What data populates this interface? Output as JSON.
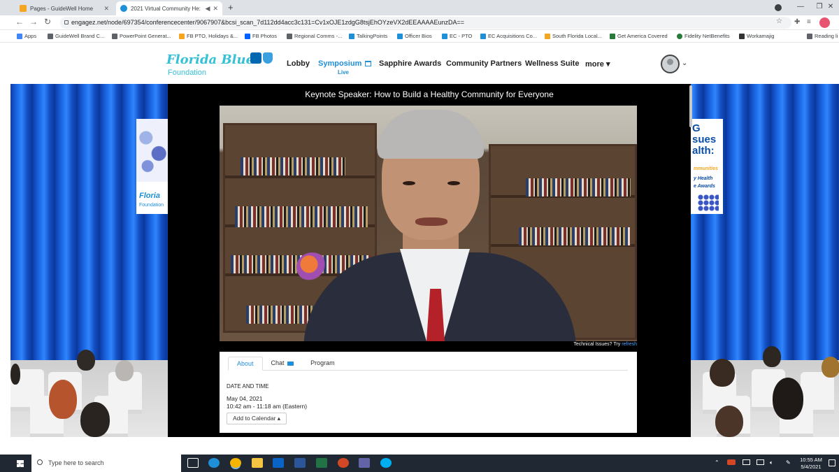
{
  "browser": {
    "tabs": [
      {
        "title": "Pages - GuideWell Home",
        "close": "✕"
      },
      {
        "title": "2021 Virtual Community He:",
        "audio": "◀",
        "close": "✕"
      }
    ],
    "new_tab": "+",
    "window_controls": {
      "minimize": "—",
      "maximize": "❐",
      "close": "✕"
    },
    "url": "engagez.net/node/697354/conferencecenter/9067907&bcsi_scan_7d112dd4acc3c131=Cv1xOJE1zdgG8tsjEhOYzeVX2dEEAAAAEunzDA==",
    "bookmarks": [
      {
        "label": "Apps",
        "color": "#4285f4"
      },
      {
        "label": "GuideWell Brand C...",
        "color": "#5f6368"
      },
      {
        "label": "PowerPoint Generat...",
        "color": "#5f6368"
      },
      {
        "label": "FB PTO, Holidays &...",
        "color": "#f4a620"
      },
      {
        "label": "FB Photos",
        "color": "#0061fe"
      },
      {
        "label": "Regional Comms -...",
        "color": "#5f6368"
      },
      {
        "label": "TalkingPoints",
        "color": "#1f8fd8"
      },
      {
        "label": "Officer Bios",
        "color": "#1f8fd8"
      },
      {
        "label": "EC - PTO",
        "color": "#1f8fd8"
      },
      {
        "label": "EC Acquisitions Co...",
        "color": "#1f8fd8"
      },
      {
        "label": "South Florida Local...",
        "color": "#f4a620"
      },
      {
        "label": "Get America Covered",
        "color": "#2a7a3a"
      },
      {
        "label": "Fidelity NetBenefits",
        "color": "#2a7a3a"
      },
      {
        "label": "Workamajig",
        "color": "#333333"
      },
      {
        "label": "Reading li",
        "color": "#5f6368"
      }
    ]
  },
  "site": {
    "brand": "Florida Blue",
    "brand_sub": "Foundation",
    "nav": [
      {
        "label": "Lobby"
      },
      {
        "label": "Symposium"
      },
      {
        "label": "Sapphire Awards"
      },
      {
        "label": "Community Partners"
      },
      {
        "label": "Wellness Suite"
      },
      {
        "label": "more"
      }
    ],
    "live_label": "Live",
    "more_caret": "▾",
    "avatar_caret": "⌄"
  },
  "stage": {
    "left_banner": {
      "text": "Floria",
      "sub": "Foundation"
    },
    "right_banner": {
      "big": "G\nsues\nalth:",
      "line1": "mmunities",
      "line2": "y Health",
      "line3": "e Awards"
    }
  },
  "session": {
    "title": "Keynote Speaker: How to Build a Healthy Community for Everyone",
    "tech_issues": "Technical Issues? Try",
    "refresh": "refresh",
    "tabs": {
      "about": "About",
      "chat": "Chat",
      "program": "Program"
    },
    "date_label": "DATE AND TIME",
    "date": "May 04, 2021",
    "time": "10:42 am - 11:18 am (Eastern)",
    "add_calendar": "Add to Calendar ▴"
  },
  "taskbar": {
    "search_placeholder": "Type here to search",
    "time": "10:55 AM",
    "date": "5/4/2021",
    "apps": [
      {
        "name": "task-view",
        "color": "#ffffff"
      },
      {
        "name": "edge",
        "color": "#1f8fd8"
      },
      {
        "name": "chrome",
        "color": "#f4b400"
      },
      {
        "name": "file-explorer",
        "color": "#f4c542"
      },
      {
        "name": "outlook",
        "color": "#0a64c8"
      },
      {
        "name": "word",
        "color": "#2b579a"
      },
      {
        "name": "excel",
        "color": "#217346"
      },
      {
        "name": "powerpoint",
        "color": "#d24726"
      },
      {
        "name": "teams",
        "color": "#6264a7"
      },
      {
        "name": "skype",
        "color": "#00aff0"
      }
    ]
  },
  "colors": {
    "brand": "#35c0d6",
    "accent": "#1f8fd8",
    "curtain": "#1d6be6"
  }
}
